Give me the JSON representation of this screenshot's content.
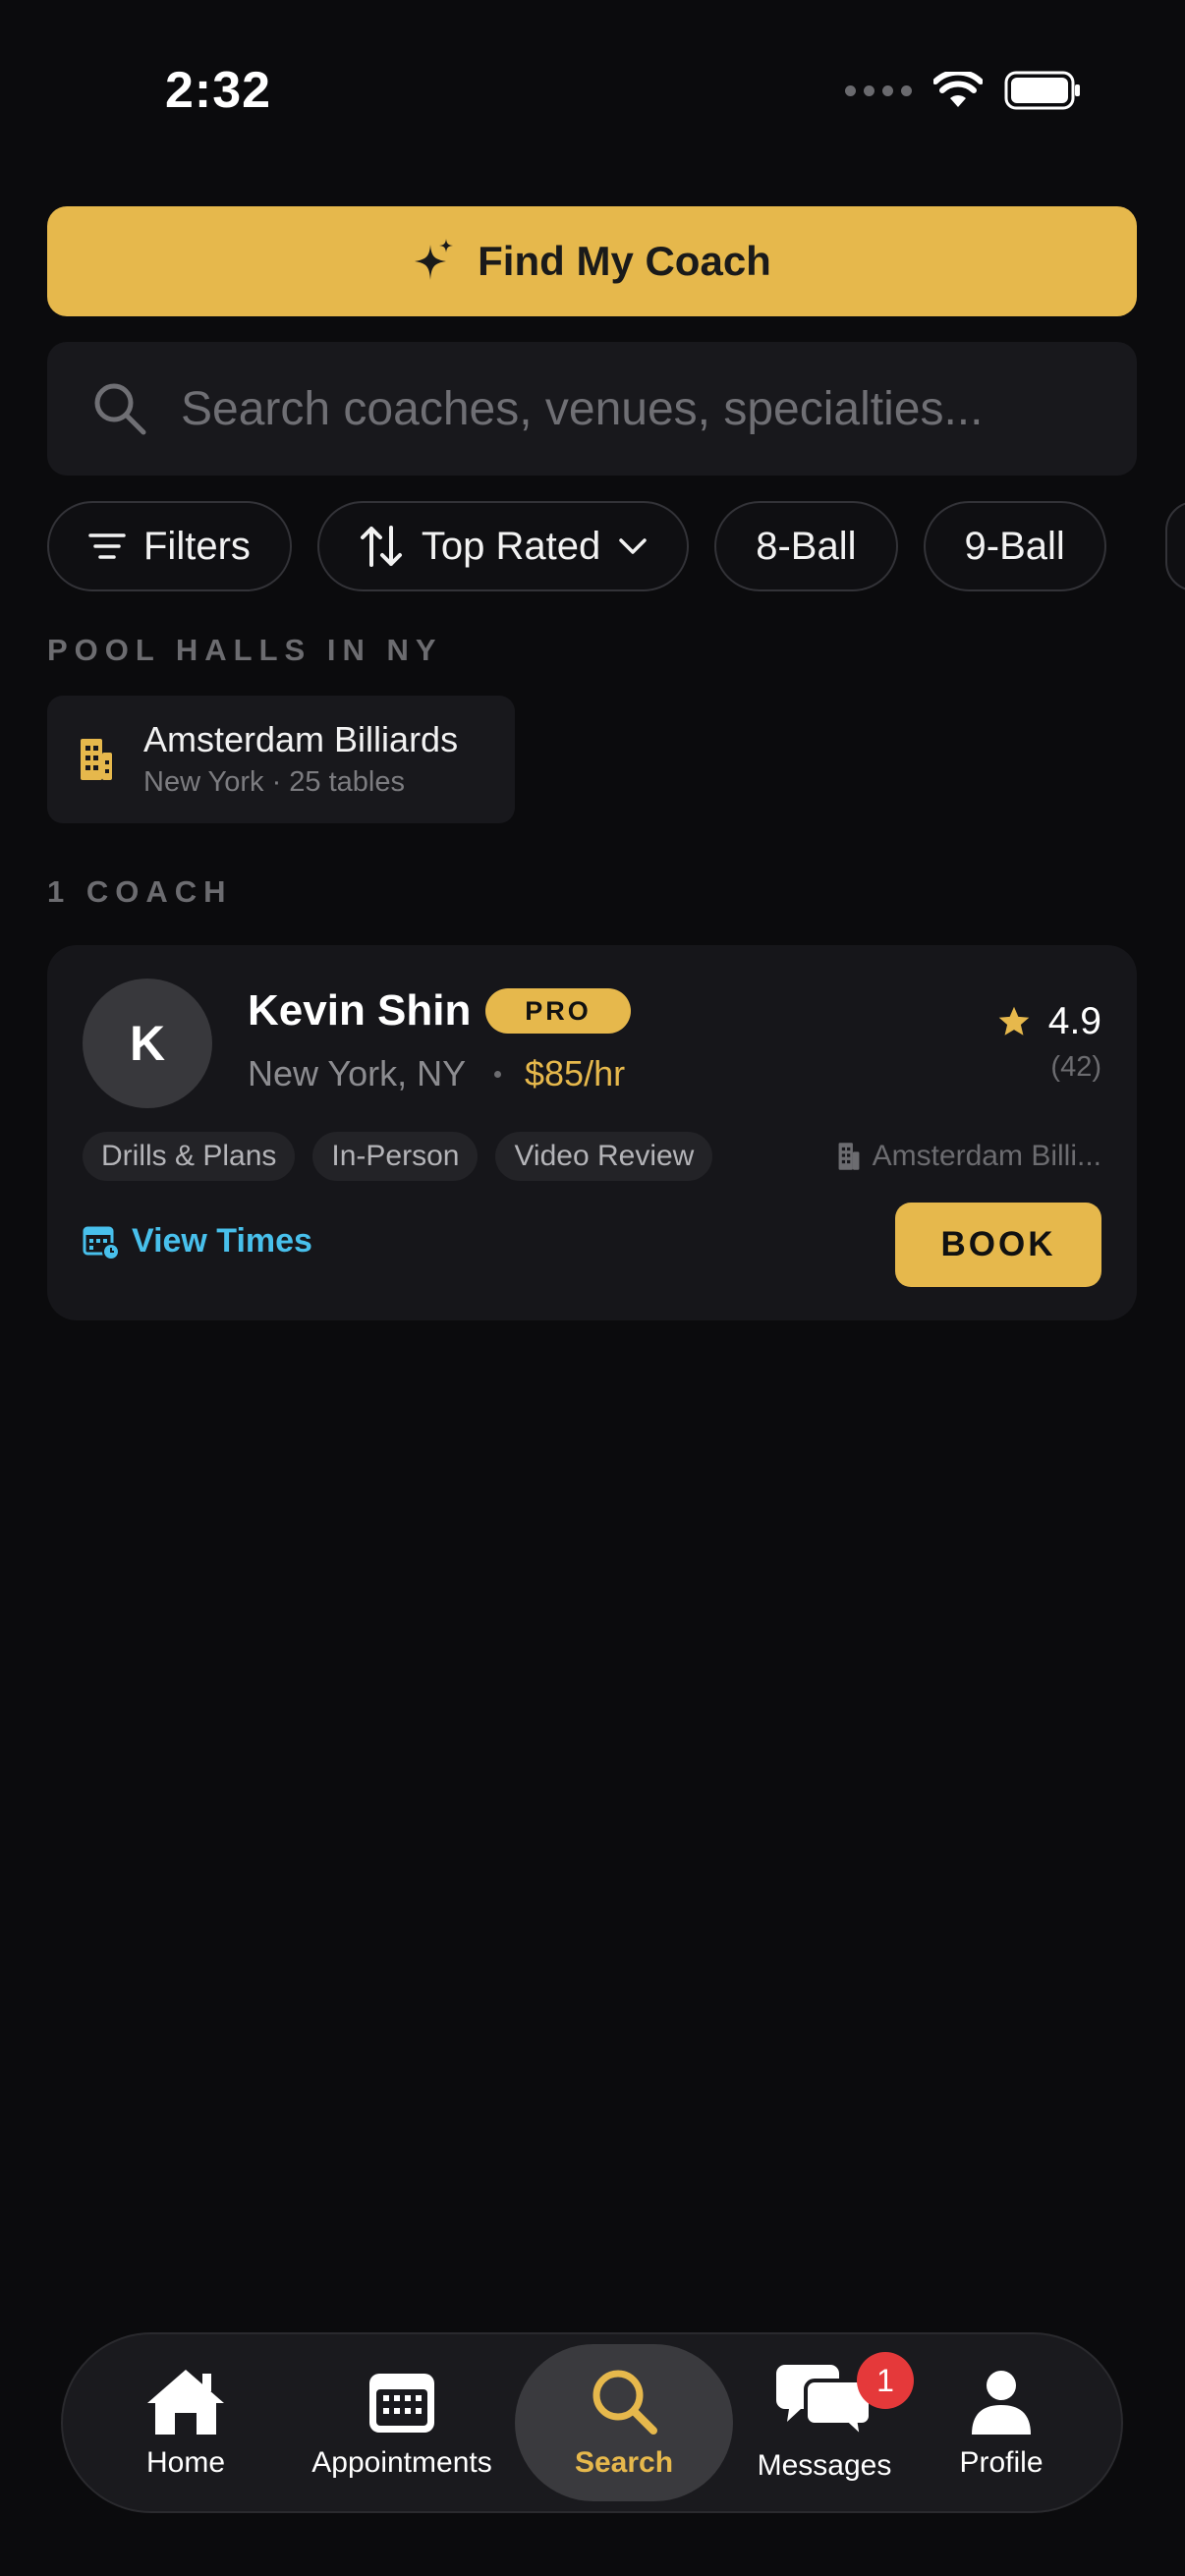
{
  "status_bar": {
    "time": "2:32"
  },
  "find_coach": {
    "label": "Find My Coach"
  },
  "search": {
    "placeholder": "Search coaches, venues, specialties..."
  },
  "chips": [
    {
      "label": "Filters",
      "icon": "filter-lines-icon"
    },
    {
      "label": "Top Rated",
      "icon": "sort-arrows-icon",
      "trailing_icon": "chevron-down-icon"
    },
    {
      "label": "8-Ball"
    },
    {
      "label": "9-Ball"
    }
  ],
  "pool_halls": {
    "heading": "POOL HALLS IN NY",
    "items": [
      {
        "name": "Amsterdam Billiards",
        "subtitle": "New York · 25 tables",
        "icon": "building-icon"
      }
    ]
  },
  "coaches": {
    "heading": "1 COACH",
    "items": [
      {
        "initial": "K",
        "name": "Kevin Shin",
        "badge": "PRO",
        "location": "New York, NY",
        "rate": "$85/hr",
        "rating": "4.9",
        "review_count": "(42)",
        "tags": [
          "Drills & Plans",
          "In-Person",
          "Video Review"
        ],
        "venue": "Amsterdam Billi...",
        "view_times_label": "View Times",
        "book_label": "BOOK"
      }
    ]
  },
  "tab_bar": {
    "active": "Search",
    "tabs": [
      {
        "label": "Home",
        "icon": "home-icon"
      },
      {
        "label": "Appointments",
        "icon": "calendar-icon"
      },
      {
        "label": "Search",
        "icon": "search-icon"
      },
      {
        "label": "Messages",
        "icon": "chat-bubbles-icon",
        "badge": "1"
      },
      {
        "label": "Profile",
        "icon": "person-icon"
      }
    ]
  },
  "colors": {
    "background": "#0b0b0d",
    "accent": "#e6b84c",
    "link": "#48c0ec",
    "badge": "#e5393a",
    "card": "#16161a"
  }
}
